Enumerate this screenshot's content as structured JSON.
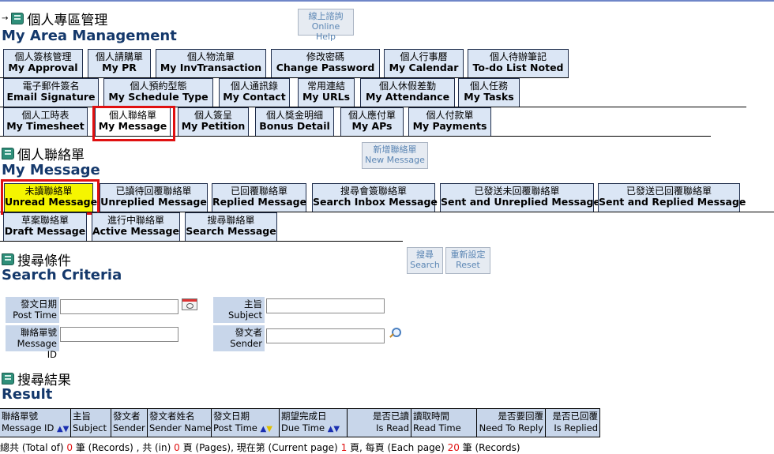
{
  "header": {
    "title_zh": "個人專區管理",
    "title_en": "My Area Management",
    "help_zh": "線上諮詢",
    "help_en": "Online Help"
  },
  "area_tabs_row1": [
    {
      "zh": "個人簽核管理",
      "en": "My Approval"
    },
    {
      "zh": "個人請購單",
      "en": "My PR"
    },
    {
      "zh": "個人物流單",
      "en": "My InvTransaction"
    },
    {
      "zh": "修改密碼",
      "en": "Change Password"
    },
    {
      "zh": "個人行事曆",
      "en": "My Calendar"
    },
    {
      "zh": "個人待辦筆記",
      "en": "To-do List Noted"
    }
  ],
  "area_tabs_row2": [
    {
      "zh": "電子郵件簽名",
      "en": "Email Signature"
    },
    {
      "zh": "個人預約型態",
      "en": "My Schedule Type"
    },
    {
      "zh": "個人通訊錄",
      "en": "My Contact"
    },
    {
      "zh": "常用連結",
      "en": "My URLs"
    },
    {
      "zh": "個人休假差勤",
      "en": "My Attendance"
    },
    {
      "zh": "個人任務",
      "en": "My Tasks"
    }
  ],
  "area_tabs_row3": [
    {
      "zh": "個人工時表",
      "en": "My Timesheet"
    },
    {
      "zh": "個人聯絡單",
      "en": "My Message"
    },
    {
      "zh": "個人簽呈",
      "en": "My Petition"
    },
    {
      "zh": "個人獎金明細",
      "en": "Bonus Detail"
    },
    {
      "zh": "個人應付單",
      "en": "My APs"
    },
    {
      "zh": "個人付款單",
      "en": "My Payments"
    }
  ],
  "message_section": {
    "title_zh": "個人聯絡單",
    "title_en": "My Message",
    "new_zh": "新增聯絡單",
    "new_en": "New Message"
  },
  "message_tabs_row1": [
    {
      "zh": "未讀聯絡單",
      "en": "Unread Message"
    },
    {
      "zh": "已讀待回覆聯絡單",
      "en": "Unreplied Message"
    },
    {
      "zh": "已回覆聯絡單",
      "en": "Replied Message"
    },
    {
      "zh": "搜尋會簽聯絡單",
      "en": "Search Inbox Message"
    },
    {
      "zh": "已發送未回覆聯絡單",
      "en": "Sent and Unreplied Message"
    },
    {
      "zh": "已發送已回覆聯絡單",
      "en": "Sent and Replied Message"
    }
  ],
  "message_tabs_row2": [
    {
      "zh": "草案聯絡單",
      "en": "Draft Message"
    },
    {
      "zh": "進行中聯絡單",
      "en": "Active Message"
    },
    {
      "zh": "搜尋聯絡單",
      "en": "Search Message"
    }
  ],
  "search": {
    "title_zh": "搜尋條件",
    "title_en": "Search Criteria",
    "search_zh": "搜尋",
    "search_en": "Search",
    "reset_zh": "重新設定",
    "reset_en": "Reset",
    "post_time_zh": "發文日期",
    "post_time_en": "Post Time",
    "message_id_zh": "聯絡單號",
    "message_id_en": "Message ID",
    "subject_zh": "主旨",
    "subject_en": "Subject",
    "sender_zh": "發文者",
    "sender_en": "Sender",
    "post_time_value": "",
    "message_id_value": "",
    "subject_value": "",
    "sender_value": ""
  },
  "result": {
    "title_zh": "搜尋結果",
    "title_en": "Result",
    "columns": [
      {
        "zh": "聯絡單號",
        "en": "Message ID"
      },
      {
        "zh": "主旨",
        "en": "Subject"
      },
      {
        "zh": "發文者",
        "en": "Sender"
      },
      {
        "zh": "發文者姓名",
        "en": "Sender Name"
      },
      {
        "zh": "發文日期",
        "en": "Post Time"
      },
      {
        "zh": "期望完成日",
        "en": "Due Time"
      },
      {
        "zh": "是否已讀",
        "en": "Is Read"
      },
      {
        "zh": "讀取時間",
        "en": "Read Time"
      },
      {
        "zh": "是否要回覆",
        "en": "Need To Reply"
      },
      {
        "zh": "是否已回覆",
        "en": "Is Replied"
      }
    ],
    "footer": {
      "p1": "總共 (Total of) ",
      "total": "0",
      "p2": " 筆 (Records) , 共 (in) ",
      "pages": "0",
      "p3": " 頁 (Pages), 現在第 (Current page) ",
      "current": "1",
      "p4": " 頁, 每頁 (Each page) ",
      "each": "20",
      "p5": " 筆 (Records)"
    }
  },
  "colors": {
    "tab_bg": "#dbe6f5",
    "active_tab": "#f5f500",
    "highlight": "#e01010",
    "title": "#14386b",
    "label_bg": "#c8d6ea"
  }
}
